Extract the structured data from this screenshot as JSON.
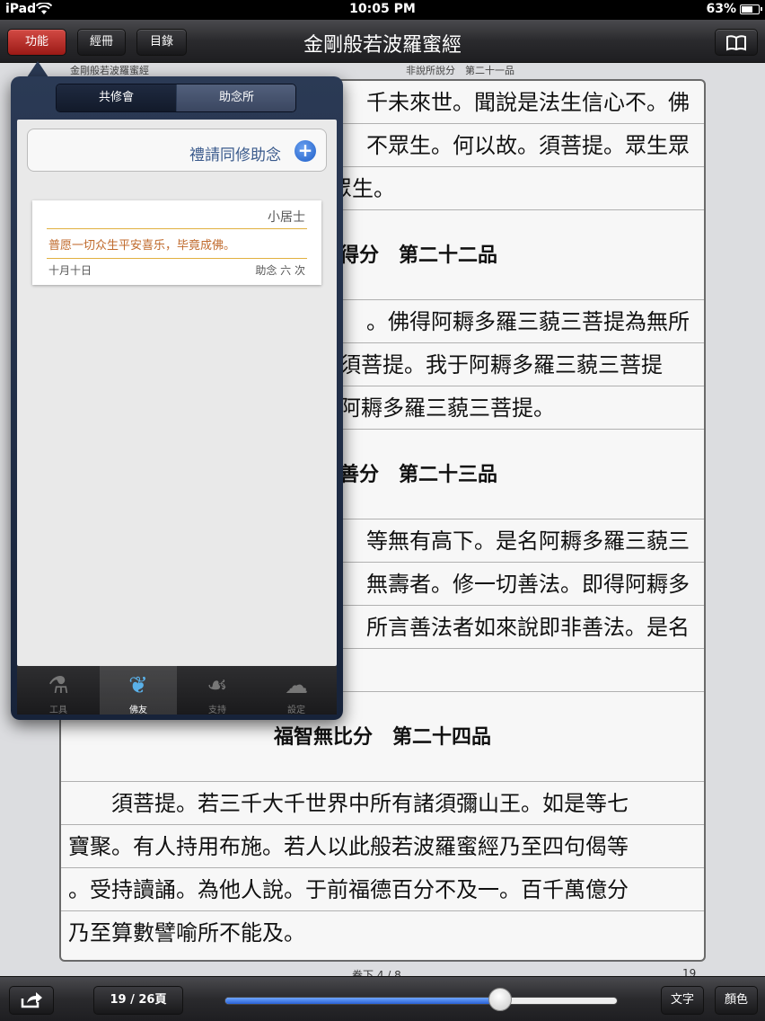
{
  "status": {
    "carrier": "iPad",
    "time": "10:05 PM",
    "battery": "63%"
  },
  "nav": {
    "func_label": "功能",
    "books_label": "經冊",
    "toc_label": "目錄",
    "title": "金剛般若波羅蜜經",
    "book_icon": "open-book-icon"
  },
  "page": {
    "running_left": "金剛般若波羅蜜經",
    "running_right": "非說所說分　第二十一品",
    "lines": [
      "千未來世。聞說是法生信心不。佛",
      "不眾生。何以故。須菩提。眾生眾",
      "眾生。",
      "得分　第二十二品",
      "。佛得阿耨多羅三藐三菩提為無所",
      "須菩提。我于阿耨多羅三藐三菩提",
      "阿耨多羅三藐三菩提。",
      "善分　第二十三品",
      "等無有高下。是名阿耨多羅三藐三",
      "無壽者。修一切善法。即得阿耨多",
      "所言善法者如來說即非善法。是名",
      "",
      "福智無比分　第二十四品",
      "　　須菩提。若三千大千世界中所有諸須彌山王。如是等七",
      "寶聚。有人持用布施。若人以此般若波羅蜜經乃至四句偈等",
      "。受持讀誦。為他人說。于前福德百分不及一。百千萬億分",
      "乃至算數譬喻所不能及。"
    ],
    "footer_left": "卷下 4 / 8",
    "footer_right": "19"
  },
  "popover": {
    "seg_left": "共修會",
    "seg_right": "助念所",
    "invite_label": "禮請同修助念",
    "card": {
      "name": "小居士",
      "wish": "普愿一切众生平安喜乐，毕竟成佛。",
      "date": "十月十日",
      "count": "助念 六 次"
    },
    "tabs": [
      {
        "label": "工具",
        "icon": "tools-icon"
      },
      {
        "label": "佛友",
        "icon": "dharma-friend-icon"
      },
      {
        "label": "支持",
        "icon": "praying-hands-icon"
      },
      {
        "label": "設定",
        "icon": "settings-cloud-icon"
      }
    ]
  },
  "toolbar": {
    "page_label": "19 / 26頁",
    "progress": 0.7,
    "text_label": "文字",
    "color_label": "顏色",
    "share_icon": "share-icon"
  }
}
